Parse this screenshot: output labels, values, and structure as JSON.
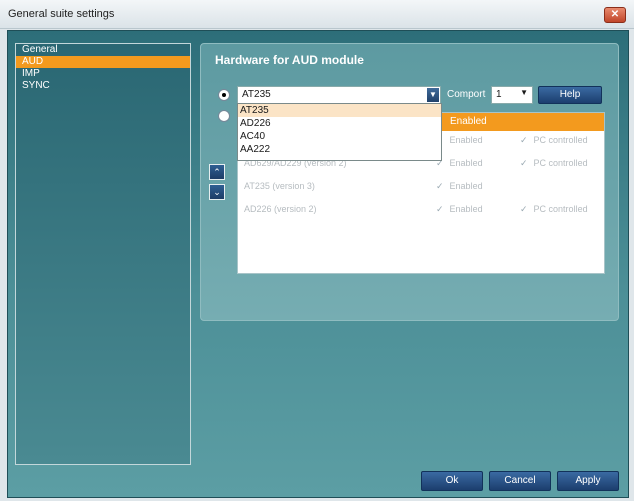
{
  "window": {
    "title": "General suite settings",
    "close_icon": "close-icon"
  },
  "sidebar": {
    "items": [
      {
        "label": "General",
        "selected": false
      },
      {
        "label": "AUD",
        "selected": true
      },
      {
        "label": "IMP",
        "selected": false
      },
      {
        "label": "SYNC",
        "selected": false
      }
    ]
  },
  "panel": {
    "title": "Hardware for AUD module",
    "device_select": {
      "value": "AT235",
      "options": [
        "AT235",
        "AD226",
        "AC40",
        "AA222"
      ],
      "highlighted": "AT235"
    },
    "comport_label": "Comport",
    "comport_value": "1",
    "help_label": "Help"
  },
  "table": {
    "header_enabled": "Enabled",
    "rows": [
      {
        "device": "",
        "enabled": "Enabled",
        "pc": "PC controlled"
      },
      {
        "device": "AD629/AD229 (version 2)",
        "enabled": "Enabled",
        "pc": "PC controlled"
      },
      {
        "device": "AT235 (version 3)",
        "enabled": "Enabled",
        "pc": ""
      },
      {
        "device": "AD226 (version 2)",
        "enabled": "Enabled",
        "pc": "PC controlled"
      }
    ]
  },
  "footer": {
    "ok": "Ok",
    "cancel": "Cancel",
    "apply": "Apply"
  },
  "colors": {
    "accent": "#f39a1e",
    "teal": "#2d6e79",
    "button_blue": "#1c3e6e"
  }
}
